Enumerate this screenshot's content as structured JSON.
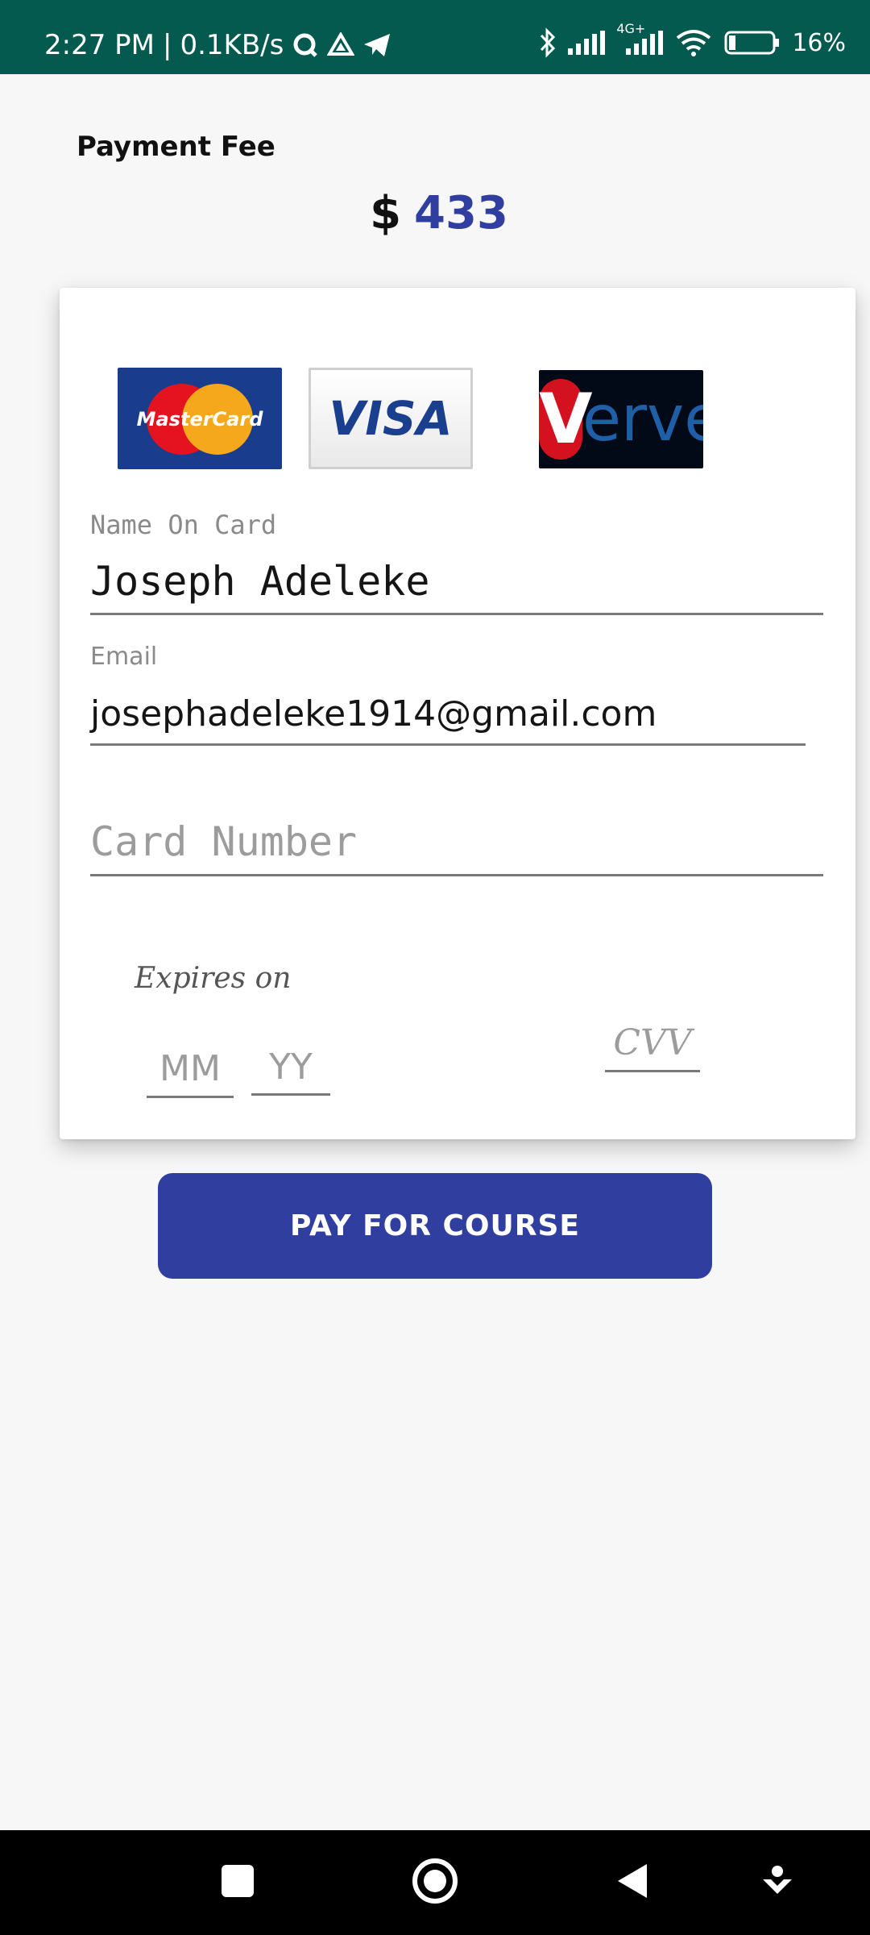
{
  "status_bar": {
    "time": "2:27 PM",
    "separator": "|",
    "net_speed": "0.1KB/s",
    "network_label": "4G+",
    "battery": "16%"
  },
  "payment": {
    "label": "Payment Fee",
    "currency": "$",
    "amount": "433"
  },
  "card_logos": {
    "mastercard": "MasterCard",
    "visa": "VISA",
    "verve_initial": "V",
    "verve_rest": "erve"
  },
  "form": {
    "name_label": "Name On Card",
    "name_value": "Joseph Adeleke",
    "email_label": "Email",
    "email_value": "josephadeleke1914@gmail.com",
    "card_number_placeholder": "Card Number",
    "expires_label": "Expires on",
    "month_placeholder": "MM",
    "year_placeholder": "YY",
    "cvv_placeholder": "CVV"
  },
  "pay_button_label": "PAY FOR COURSE",
  "colors": {
    "status_bar": "#045a4e",
    "accent": "#303f9f",
    "background": "#f7f7f8"
  },
  "icons": {
    "status_left": [
      "q-app-icon",
      "drive-icon",
      "telegram-icon"
    ],
    "status_right": [
      "bluetooth-icon",
      "signal-icon",
      "signal-4g-icon",
      "wifi-icon",
      "battery-icon"
    ],
    "nav": [
      "recents-icon",
      "home-icon",
      "back-icon",
      "assist-icon"
    ]
  }
}
